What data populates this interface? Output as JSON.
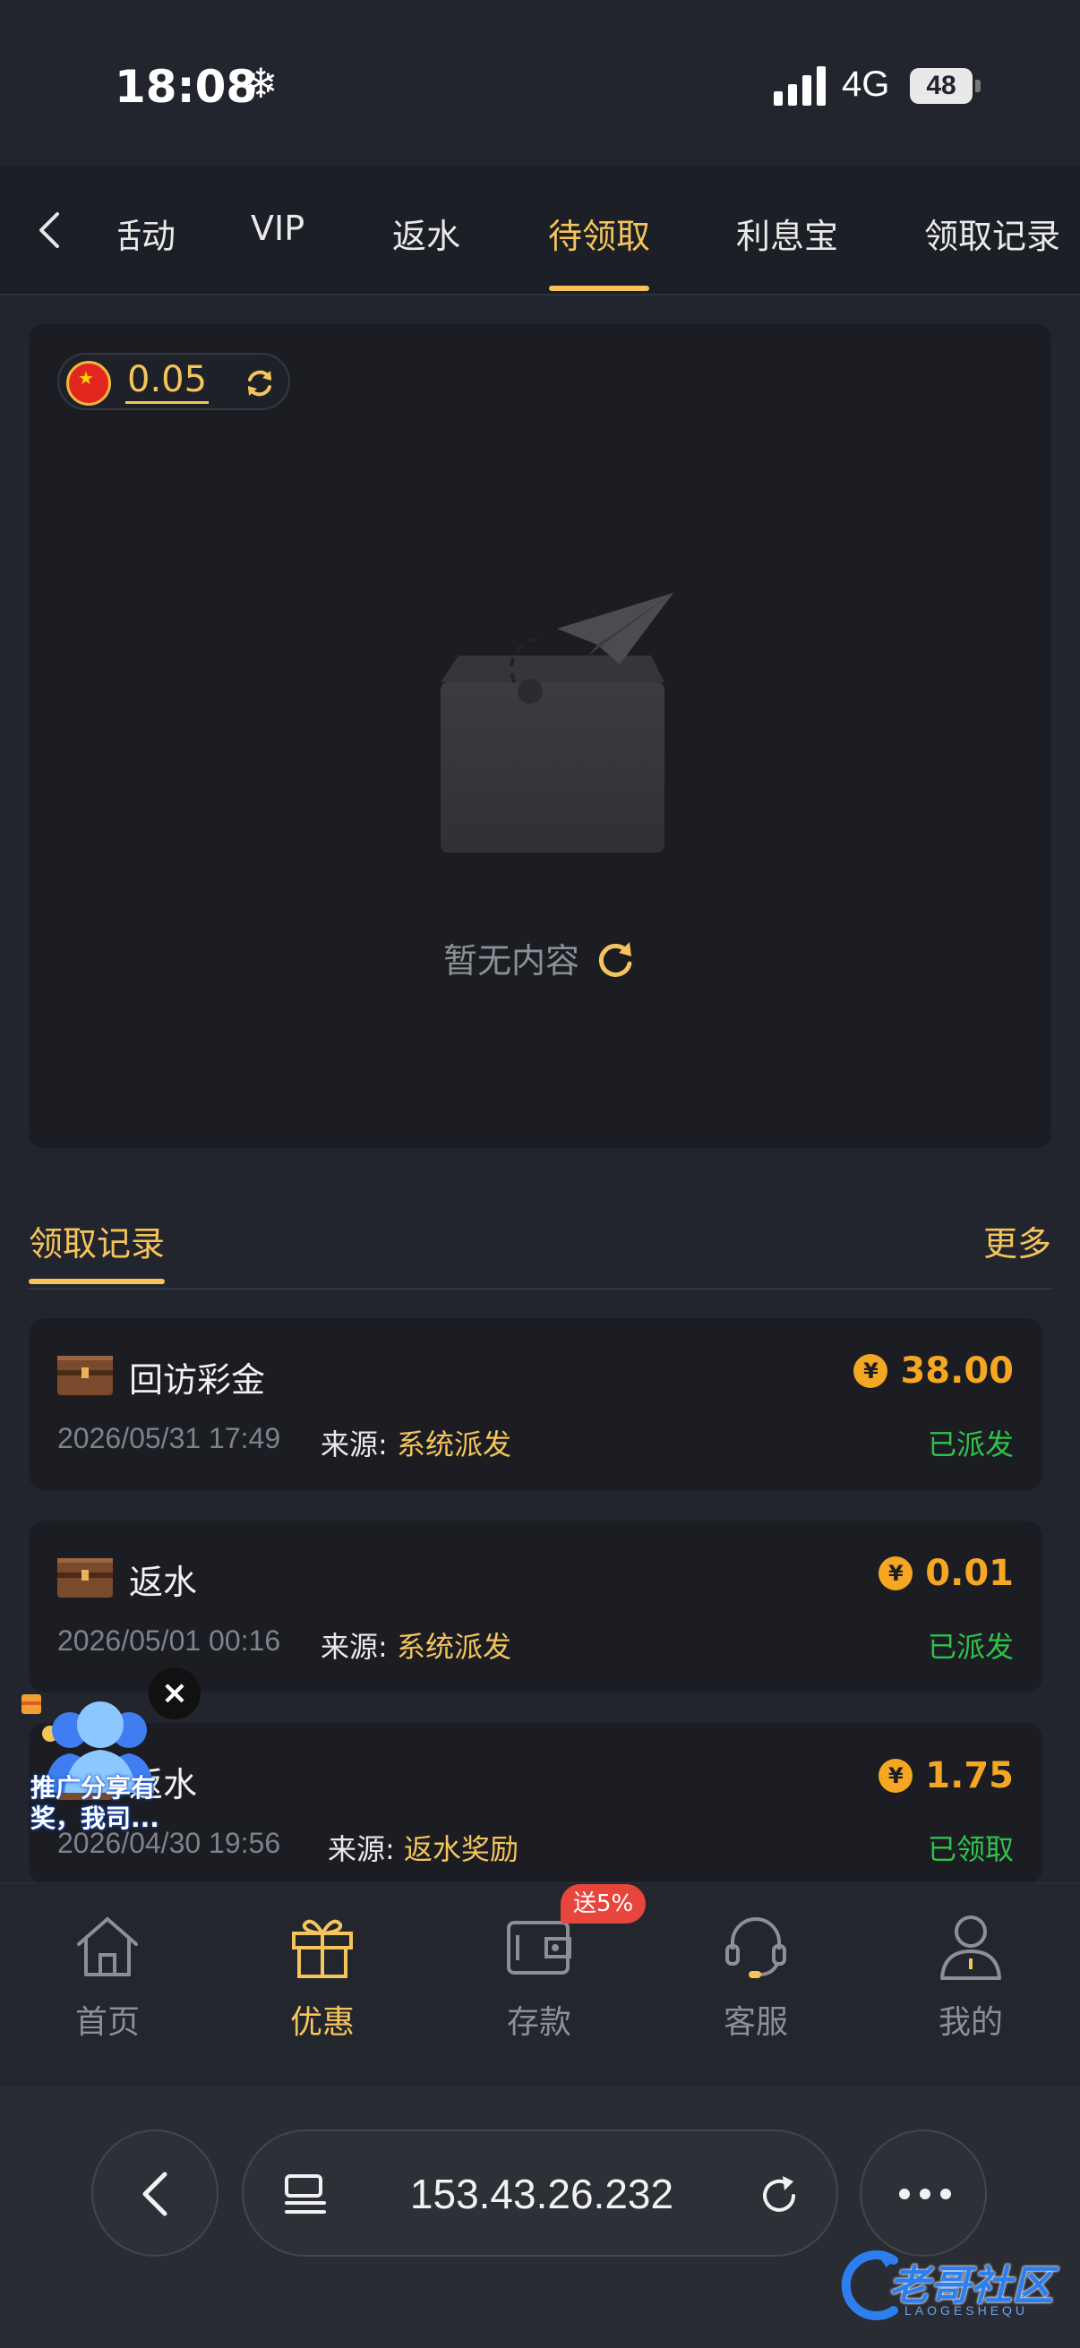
{
  "status": {
    "time": "18:08",
    "network": "4G",
    "battery": "48"
  },
  "tabs": [
    {
      "label": "活动"
    },
    {
      "label": "VIP"
    },
    {
      "label": "返水"
    },
    {
      "label": "待领取"
    },
    {
      "label": "利息宝"
    },
    {
      "label": "领取记录"
    }
  ],
  "balance": {
    "value": "0.05"
  },
  "empty": {
    "text": "暂无内容"
  },
  "records": {
    "title": "领取记录",
    "more": "更多",
    "source_label": "来源:",
    "items": [
      {
        "name": "回访彩金",
        "amount": "38.00",
        "time": "2026/05/31 17:49",
        "source": "系统派发",
        "status": "已派发"
      },
      {
        "name": "返水",
        "amount": "0.01",
        "time": "2026/05/01 00:16",
        "source": "系统派发",
        "status": "已派发"
      },
      {
        "name": "返水",
        "amount": "1.75",
        "time": "2026/04/30 19:56",
        "source": "返水奖励",
        "status": "已领取"
      }
    ]
  },
  "promo": {
    "text": "推广分享有奖，我司..."
  },
  "nav": [
    {
      "label": "首页"
    },
    {
      "label": "优惠"
    },
    {
      "label": "存款",
      "badge": "送5%"
    },
    {
      "label": "客服"
    },
    {
      "label": "我的"
    }
  ],
  "browser": {
    "url": "153.43.26.232"
  },
  "watermark": {
    "text": "老哥社区",
    "sub": "LAOGESHEQU"
  },
  "colors": {
    "accent": "#f5c45b",
    "amount": "#f5a623",
    "success": "#2fc24a",
    "badge": "#e8463c"
  }
}
